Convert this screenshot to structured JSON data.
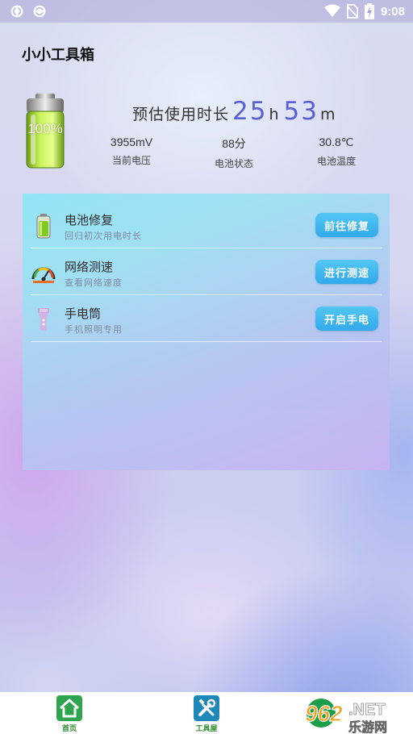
{
  "status_bar": {
    "time": "9:08",
    "left_icons": [
      "app-notification-icon",
      "app-notification-icon"
    ],
    "right_icons": [
      "wifi-icon",
      "no-sim-icon",
      "battery-charging-icon"
    ]
  },
  "app_title": "小小工具箱",
  "battery": {
    "percent_text": "100%",
    "level": 1.0
  },
  "estimate": {
    "label": "预估使用时长",
    "hours": "25",
    "hours_unit": "h",
    "minutes": "53",
    "minutes_unit": "m"
  },
  "stats": [
    {
      "value": "3955mV",
      "label": "当前电压"
    },
    {
      "value": "88分",
      "label": "电池状态"
    },
    {
      "value": "30.8℃",
      "label": "电池温度"
    }
  ],
  "tools": [
    {
      "title": "电池修复",
      "subtitle": "回归初次用电时长",
      "button": "前往修复",
      "icon": "battery-icon"
    },
    {
      "title": "网络测速",
      "subtitle": "查看网络速度",
      "button": "进行测速",
      "icon": "speedometer-icon"
    },
    {
      "title": "手电筒",
      "subtitle": "手机照明专用",
      "button": "开启手电",
      "icon": "flashlight-icon"
    }
  ],
  "tabbar": {
    "items": [
      {
        "label": "首页",
        "icon": "home-icon"
      },
      {
        "label": "工具屋",
        "icon": "tools-icon"
      }
    ]
  },
  "watermark": {
    "number": "962",
    "suffix": ".NET",
    "text": "乐游网"
  },
  "colors": {
    "accent": "#5a5fd6",
    "button": "#2aa8ea",
    "tab_green": "#2ea44f"
  }
}
